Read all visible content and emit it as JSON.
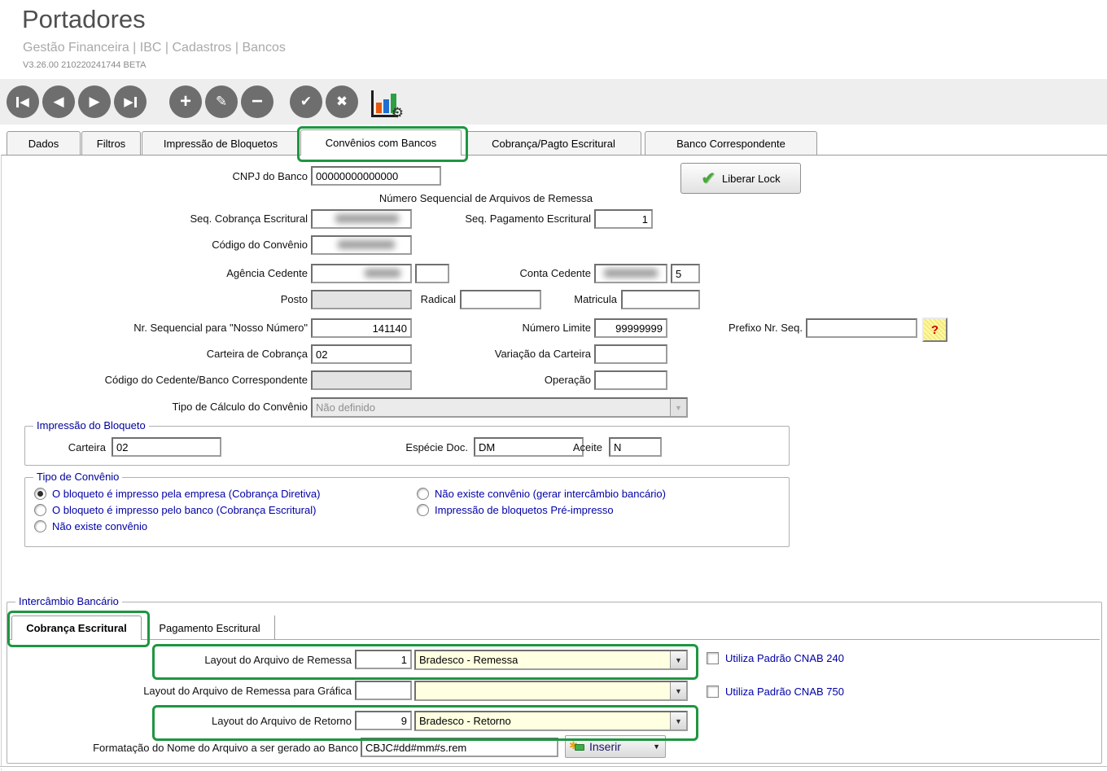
{
  "header": {
    "title": "Portadores",
    "breadcrumb": "Gestão Financeira | IBC | Cadastros | Bancos",
    "version": "V3.26.00 210220241744 BETA"
  },
  "toolbar": {
    "icons": [
      "first-record",
      "previous-record",
      "next-record",
      "last-record",
      "add",
      "edit",
      "delete",
      "confirm",
      "cancel",
      "chart-settings"
    ],
    "glyphs": {
      "add": "+",
      "edit": "✎",
      "delete": "−",
      "confirm": "✔",
      "cancel": "✖",
      "gear": "⚙",
      "prev": "◀",
      "next": "▶",
      "dropdown": "▼",
      "star": "✱",
      "check": "✔",
      "help": "?"
    }
  },
  "tabs": [
    {
      "label": "Dados",
      "active": false
    },
    {
      "label": "Filtros",
      "active": false
    },
    {
      "label": "Impressão de Bloquetos",
      "active": false
    },
    {
      "label": "Convênios com Bancos",
      "active": true,
      "annotated": true
    },
    {
      "label": "Cobrança/Pagto Escritural",
      "active": false
    },
    {
      "label": "Banco Correspondente",
      "active": false
    }
  ],
  "form": {
    "cnpj_label": "CNPJ do Banco",
    "cnpj_value": "00000000000000",
    "liberar_lock_label": "Liberar Lock",
    "seq_header": "Número Sequencial de Arquivos de Remessa",
    "seq_cobranca_label": "Seq. Cobrança Escritural",
    "seq_cobranca_value": "",
    "seq_pagamento_label": "Seq. Pagamento Escritural",
    "seq_pagamento_value": "1",
    "codigo_convenio_label": "Código do Convênio",
    "codigo_convenio_value": "",
    "agencia_label": "Agência Cedente",
    "agencia_value": "",
    "agencia_digit": "",
    "conta_label": "Conta Cedente",
    "conta_value": "",
    "conta_digit": "5",
    "posto_label": "Posto",
    "posto_value": "",
    "radical_label": "Radical",
    "radical_value": "",
    "matricula_label": "Matricula",
    "matricula_value": "",
    "nosso_numero_label": "Nr. Sequencial para \"Nosso Número\"",
    "nosso_numero_value": "141140",
    "numero_limite_label": "Número Limite",
    "numero_limite_value": "99999999",
    "prefixo_label": "Prefixo Nr. Seq.",
    "prefixo_value": "",
    "help_button": "?",
    "carteira_cobranca_label": "Carteira de Cobrança",
    "carteira_cobranca_value": "02",
    "variacao_label": "Variação da Carteira",
    "variacao_value": "",
    "codigo_cedente_label": "Código do Cedente/Banco Correspondente",
    "codigo_cedente_value": "",
    "operacao_label": "Operação",
    "operacao_value": "",
    "tipo_calculo_label": "Tipo de Cálculo do Convênio",
    "tipo_calculo_value": "Não definido"
  },
  "impressao_bloqueto": {
    "title": "Impressão do Bloqueto",
    "carteira_label": "Carteira",
    "carteira_value": "02",
    "especie_label": "Espécie Doc.",
    "especie_value": "DM",
    "aceite_label": "Aceite",
    "aceite_value": "N"
  },
  "tipo_convenio": {
    "title": "Tipo de Convênio",
    "options": [
      {
        "label": "O bloqueto é impresso pela empresa (Cobrança Diretiva)",
        "selected": true
      },
      {
        "label": "O bloqueto é impresso pelo banco (Cobrança Escritural)",
        "selected": false
      },
      {
        "label": "Não existe convênio",
        "selected": false
      },
      {
        "label": "Não existe convênio (gerar intercâmbio bancário)",
        "selected": false
      },
      {
        "label": "Impressão de bloquetos Pré-impresso",
        "selected": false
      }
    ]
  },
  "intercambio": {
    "title": "Intercâmbio Bancário",
    "tabs": [
      {
        "label": "Cobrança Escritural",
        "active": true,
        "annotated": true
      },
      {
        "label": "Pagamento Escritural",
        "active": false
      }
    ],
    "remessa_label": "Layout do Arquivo de Remessa",
    "remessa_code": "1",
    "remessa_value": "Bradesco - Remessa",
    "grafica_label": "Layout do Arquivo de Remessa para Gráfica",
    "grafica_code": "",
    "grafica_value": "",
    "retorno_label": "Layout do Arquivo de Retorno",
    "retorno_code": "9",
    "retorno_value": "Bradesco - Retorno",
    "cnab240_label": "Utiliza Padrão CNAB 240",
    "cnab240_checked": false,
    "cnab750_label": "Utiliza Padrão CNAB 750",
    "cnab750_checked": false,
    "formatacao_label": "Formatação do Nome do Arquivo a ser gerado ao Banco",
    "formatacao_value": "CBJC#dd#mm#s.rem",
    "inserir_label": "Inserir"
  },
  "colors": {
    "annotation_green": "#1e9641",
    "combo_yellow": "#ffffe1",
    "label_navy": "#00009b",
    "option_blue": "#0000a8"
  }
}
